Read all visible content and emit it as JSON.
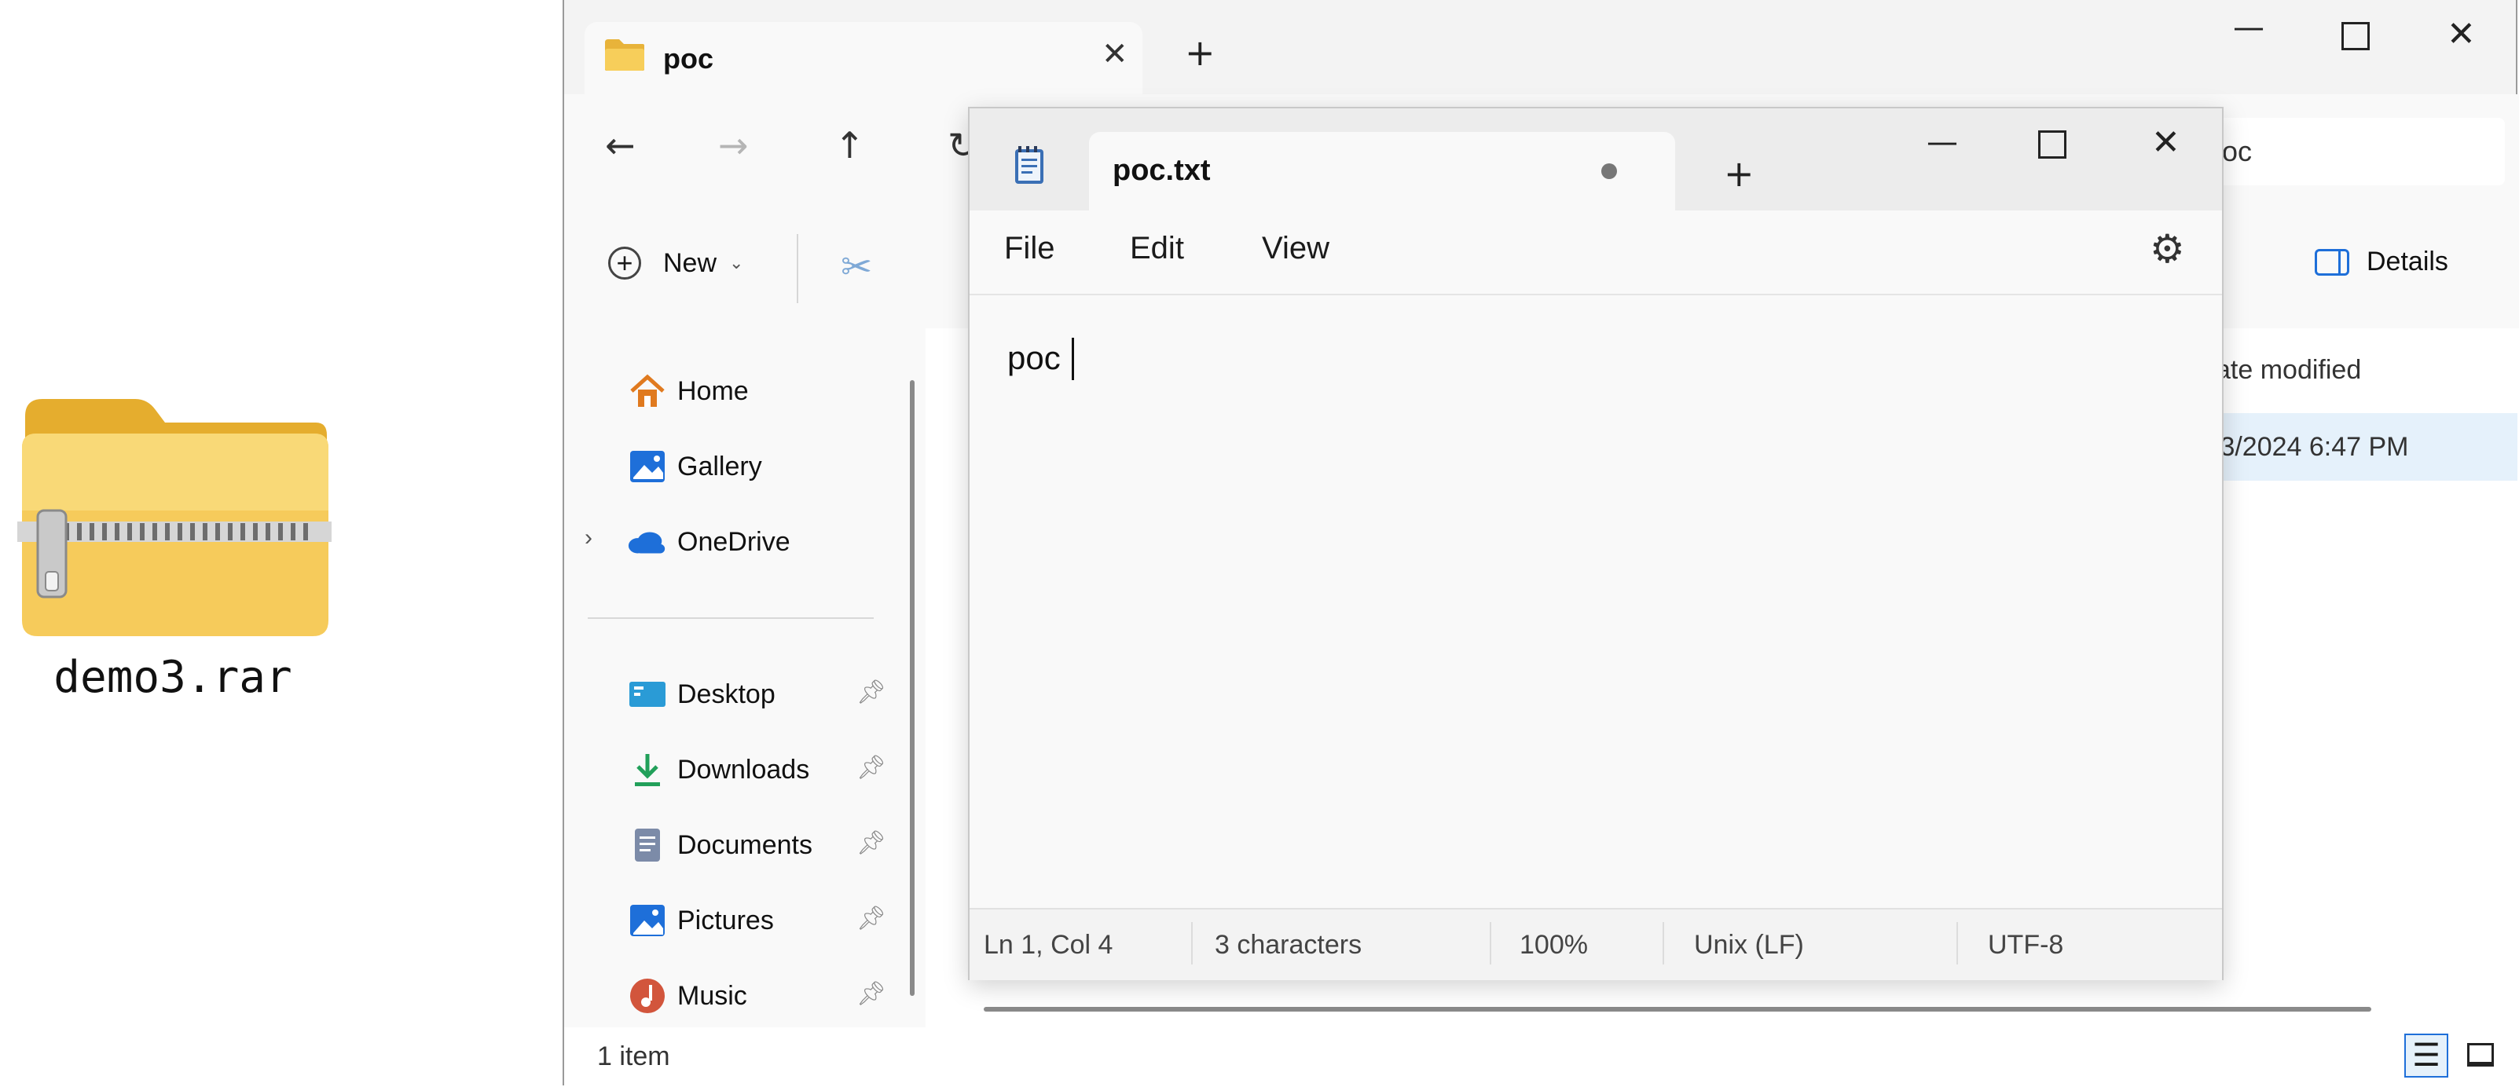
{
  "desktop": {
    "archive_label": "demo3.rar",
    "archive_icon": "zipped-folder-icon"
  },
  "explorer": {
    "tab_title": "poc",
    "address_text": "poc",
    "new_button_label": "New",
    "details_button_label": "Details",
    "column_header_partial": "ate modified",
    "row_date_partial": "/3/2024 6:47 PM",
    "nav_items": [
      {
        "label": "Home",
        "icon": "home-icon"
      },
      {
        "label": "Gallery",
        "icon": "gallery-icon"
      },
      {
        "label": "OneDrive",
        "icon": "onedrive-cloud-icon"
      },
      {
        "label": "Desktop",
        "icon": "desktop-folder-icon"
      },
      {
        "label": "Downloads",
        "icon": "downloads-icon"
      },
      {
        "label": "Documents",
        "icon": "documents-icon"
      },
      {
        "label": "Pictures",
        "icon": "pictures-icon"
      },
      {
        "label": "Music",
        "icon": "music-icon"
      }
    ],
    "status_item_count": "1 item"
  },
  "notepad": {
    "tab_title": "poc.txt",
    "menu": [
      "File",
      "Edit",
      "View"
    ],
    "content": "poc",
    "status": {
      "position": "Ln 1, Col 4",
      "characters": "3 characters",
      "zoom": "100%",
      "line_ending": "Unix (LF)",
      "encoding": "UTF-8"
    }
  },
  "colors": {
    "folder_yellow": "#f5c542",
    "accent_blue": "#1e6fd9",
    "selected_row": "#e5f1fb"
  }
}
